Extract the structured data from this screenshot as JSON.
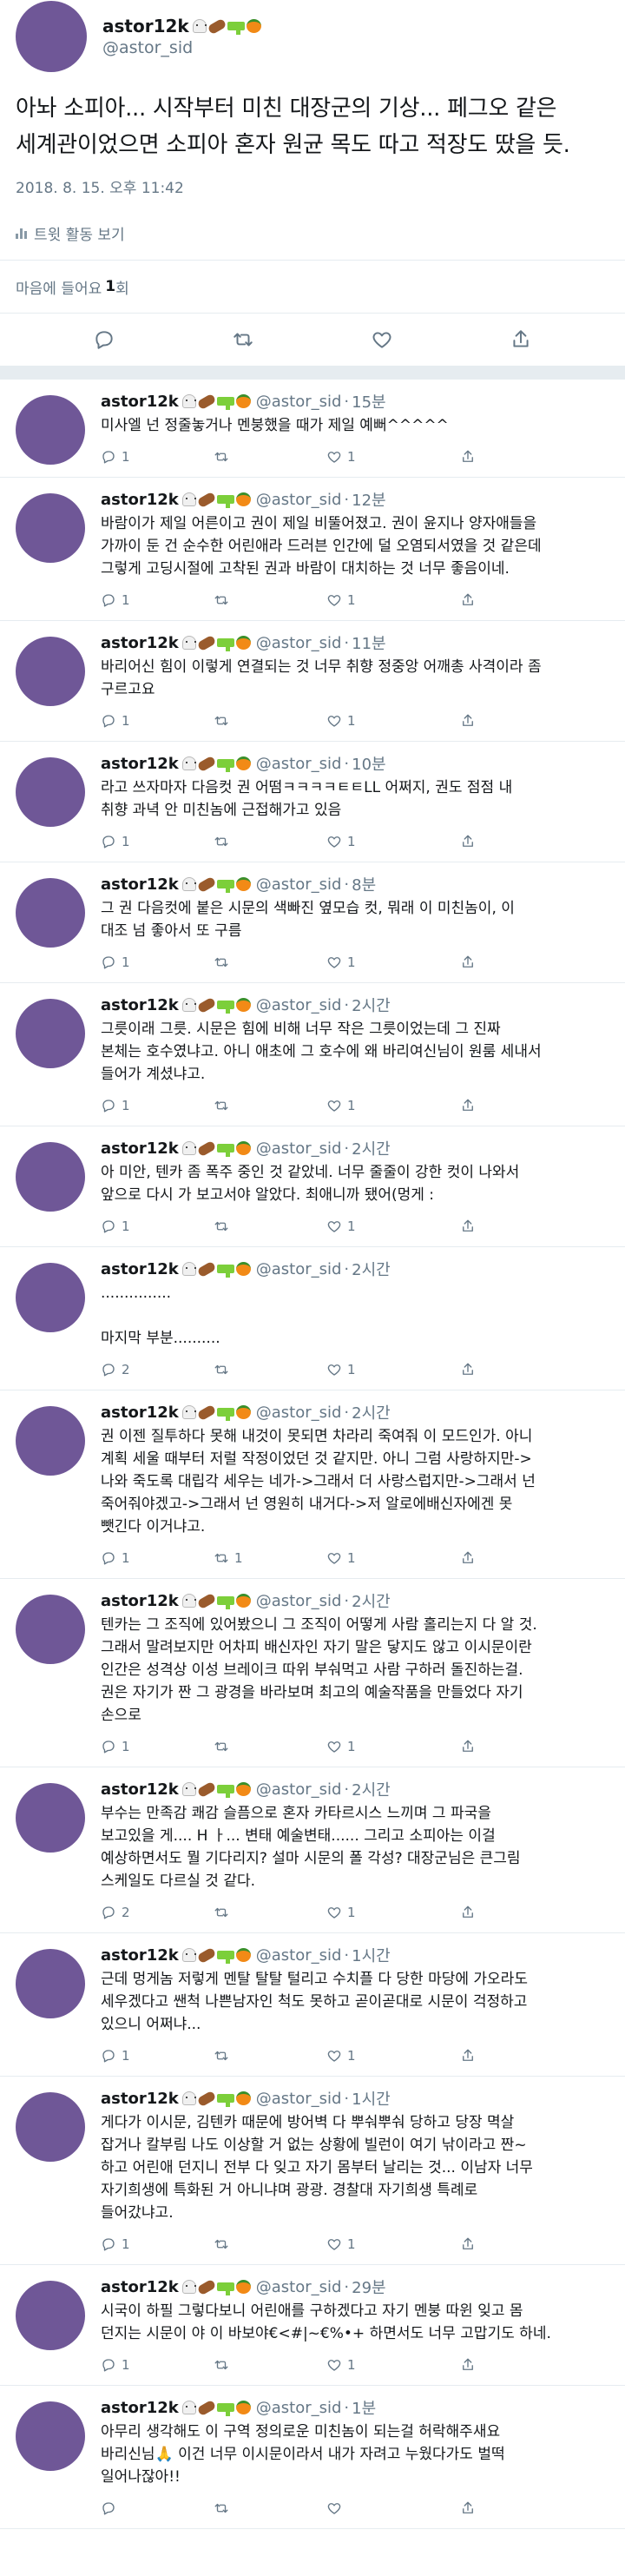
{
  "main_tweet": {
    "name": "astor12k",
    "handle": "@astor_sid",
    "text_line1": "아놔 소피아... 시작부터 미친 대장군의 기상... 페그오 같은",
    "text_line2": "세계관이었으면 소피아 혼자 원균 목도 따고 적장도 땄을 듯.",
    "timestamp": "2018. 8. 15. 오후 11:42",
    "activity_label": "트윗 활동 보기",
    "likes_label": "마음에 들어요",
    "likes_count": "1",
    "likes_suffix": "회"
  },
  "emoji_icons": [
    "ghost-emoji",
    "bread-emoji",
    "water-gun-emoji",
    "pumpkin-emoji"
  ],
  "replies": [
    {
      "name": "astor12k",
      "handle": "@astor_sid",
      "time": "15분",
      "lines": [
        "미사엘 넌 정줄놓거나 멘붕했을 때가 제일 예뻐^^^^^"
      ],
      "reply_count": "1",
      "retweet_count": "",
      "like_count": "1"
    },
    {
      "name": "astor12k",
      "handle": "@astor_sid",
      "time": "12분",
      "lines": [
        "바람이가 제일 어른이고 권이 제일 비뚤어졌고. 권이 윤지나 양자애들을",
        "가까이 둔 건 순수한 어린애라 드러븐 인간에 덜 오염되서였을 것 같은데",
        "그렇게 고딩시절에 고착된 권과 바람이 대치하는 것 너무 좋음이네."
      ],
      "reply_count": "1",
      "retweet_count": "",
      "like_count": "1"
    },
    {
      "name": "astor12k",
      "handle": "@astor_sid",
      "time": "11분",
      "lines": [
        "바리어신 힘이 이렇게 연결되는 것 너무 취향 정중앙 어깨총 사격이라 좀",
        "구르고요"
      ],
      "reply_count": "1",
      "retweet_count": "",
      "like_count": "1"
    },
    {
      "name": "astor12k",
      "handle": "@astor_sid",
      "time": "10분",
      "lines": [
        "라고 쓰자마자 다음컷 권 어떰ㅋㅋㅋㅋㅌㅌLL 어쩌지, 권도 점점 내",
        "취향 과녁 안 미친놈에 근접해가고 있음"
      ],
      "reply_count": "1",
      "retweet_count": "",
      "like_count": "1"
    },
    {
      "name": "astor12k",
      "handle": "@astor_sid",
      "time": "8분",
      "lines": [
        "그 권 다음컷에 붙은 시문의 색빠진 옆모습 컷, 뭐래 이 미친놈이, 이",
        "대조 넘 좋아서 또 구름"
      ],
      "reply_count": "1",
      "retweet_count": "",
      "like_count": "1"
    },
    {
      "name": "astor12k",
      "handle": "@astor_sid",
      "time": "2시간",
      "lines": [
        "그릇이래 그릇. 시문은 힘에 비해 너무 작은 그릇이었는데 그 진짜",
        "본체는 호수였냐고. 아니 애초에 그 호수에 왜 바리여신님이 원룸 세내서",
        "들어가 계셨냐고."
      ],
      "reply_count": "1",
      "retweet_count": "",
      "like_count": "1"
    },
    {
      "name": "astor12k",
      "handle": "@astor_sid",
      "time": "2시간",
      "lines": [
        "아 미안, 텐카 좀 폭주 중인 것 같았네. 너무 줄줄이 강한 컷이 나와서",
        "앞으로 다시 가 보고서야 알았다. 최애니까 됐어(멍게 :"
      ],
      "reply_count": "1",
      "retweet_count": "",
      "like_count": "1"
    },
    {
      "name": "astor12k",
      "handle": "@astor_sid",
      "time": "2시간",
      "lines": [
        "...............",
        "",
        "마지막 부분.........."
      ],
      "reply_count": "2",
      "retweet_count": "",
      "like_count": "1"
    },
    {
      "name": "astor12k",
      "handle": "@astor_sid",
      "time": "2시간",
      "lines": [
        "권 이젠 질투하다 못해 내것이 못되면 차라리 죽여줘 이 모드인가. 아니",
        "계획 세울 때부터 저럴 작정이었던 것 같지만. 아니 그럼 사랑하지만->",
        "나와 죽도록 대립각 세우는 네가->그래서 더 사랑스럽지만->그래서 넌",
        "죽어줘야겠고->그래서 넌 영원히 내거다->저 알로에배신자에겐 못",
        "뺏긴다 이거냐고."
      ],
      "reply_count": "1",
      "retweet_count": "1",
      "like_count": "1"
    },
    {
      "name": "astor12k",
      "handle": "@astor_sid",
      "time": "2시간",
      "lines": [
        "텐카는 그 조직에 있어봤으니 그 조직이 어떻게 사람 홀리는지 다 알 것.",
        "그래서 말려보지만 어차피 배신자인 자기 말은 닿지도 않고 이시문이란",
        "인간은 성격상 이성 브레이크 따위 부숴먹고 사람 구하러 돌진하는걸.",
        "권은 자기가 짠 그 광경을 바라보며 최고의 예술작품을 만들었다 자기",
        "손으로"
      ],
      "reply_count": "1",
      "retweet_count": "",
      "like_count": "1"
    },
    {
      "name": "astor12k",
      "handle": "@astor_sid",
      "time": "2시간",
      "lines": [
        "부수는 만족감 쾌감 슬픔으로 혼자 카타르시스 느끼며 그 파국을",
        "보고있을 게.... H ㅏ... 변태 예술변태...... 그리고 소피아는 이걸",
        "예상하면서도 뭘 기다리지? 설마 시문의 폴 각성? 대장군님은 큰그림",
        "스케일도 다르실 것 같다."
      ],
      "reply_count": "2",
      "retweet_count": "",
      "like_count": "1"
    },
    {
      "name": "astor12k",
      "handle": "@astor_sid",
      "time": "1시간",
      "lines": [
        "근데 멍게놈 저렇게 멘탈 탈탈 털리고 수치플 다 당한 마당에 가오라도",
        "세우겠다고 쌘척 나쁜남자인 척도 못하고 곧이곧대로 시문이 걱정하고",
        "있으니 어쩌냐..."
      ],
      "reply_count": "1",
      "retweet_count": "",
      "like_count": "1"
    },
    {
      "name": "astor12k",
      "handle": "@astor_sid",
      "time": "1시간",
      "lines": [
        "게다가 이시문, 김텐카 때문에 방어벽 다 뿌숴뿌숴 당하고 당장 멱살",
        "잡거나 칼부림 나도 이상할 거 없는 상황에 빌런이 여기 낚이라고 짠~",
        "하고 어린애 던지니 전부 다 잊고 자기 몸부터 날리는 것... 이남자 너무",
        "자기희생에 특화된 거 아니냐며 광광. 경찰대 자기희생 특례로",
        "들어갔냐고."
      ],
      "reply_count": "1",
      "retweet_count": "",
      "like_count": "1"
    },
    {
      "name": "astor12k",
      "handle": "@astor_sid",
      "time": "29분",
      "lines": [
        "시국이 하필 그렇다보니 어린애를 구하겠다고 자기 멘붕 따윈 잊고 몸",
        "던지는 시문이 야 이 바보야€<#|~€%•+ 하면서도 너무 고맙기도 하네."
      ],
      "reply_count": "1",
      "retweet_count": "",
      "like_count": "1"
    },
    {
      "name": "astor12k",
      "handle": "@astor_sid",
      "time": "1분",
      "lines": [
        "아무리 생각해도 이 구역 정의로운 미친놈이 되는걸 허락해주새요",
        "바리신님🙏 이건 너무 이시문이라서 내가 자려고 누웠다가도 벌떡",
        "일어나잖아!!"
      ],
      "reply_count": "",
      "retweet_count": "",
      "like_count": ""
    }
  ]
}
